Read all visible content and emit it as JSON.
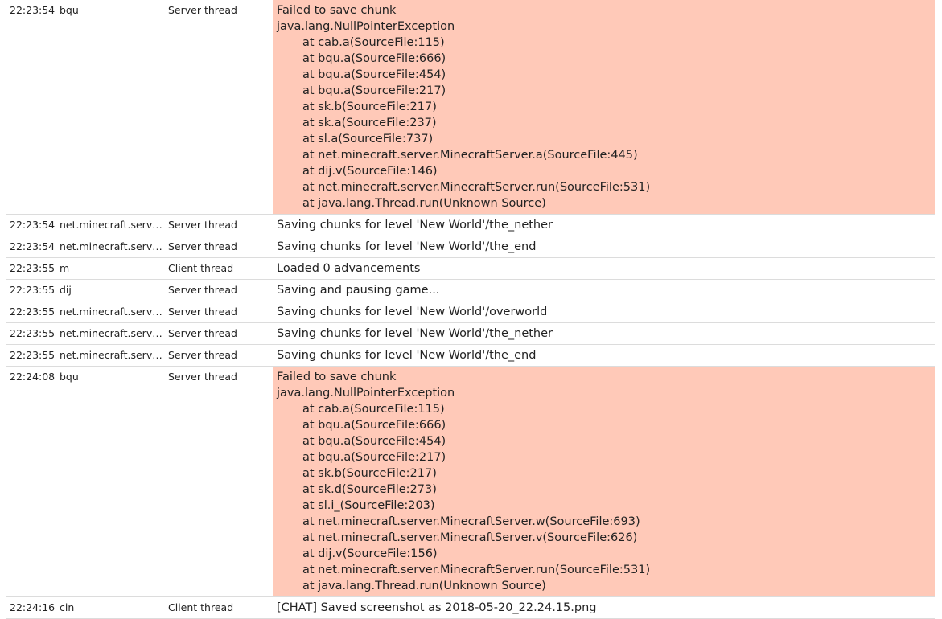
{
  "log": {
    "rows": [
      {
        "time": "22:23:54",
        "logger": "bqu",
        "thread": "Server thread",
        "error": true,
        "lines": [
          "Failed to save chunk",
          "java.lang.NullPointerException",
          "at cab.a(SourceFile:115)",
          "at bqu.a(SourceFile:666)",
          "at bqu.a(SourceFile:454)",
          "at bqu.a(SourceFile:217)",
          "at sk.b(SourceFile:217)",
          "at sk.a(SourceFile:237)",
          "at sl.a(SourceFile:737)",
          "at net.minecraft.server.MinecraftServer.a(SourceFile:445)",
          "at dij.v(SourceFile:146)",
          "at net.minecraft.server.MinecraftServer.run(SourceFile:531)",
          "at java.lang.Thread.run(Unknown Source)"
        ]
      },
      {
        "time": "22:23:54",
        "logger": "net.minecraft.server.MinecraftServer",
        "thread": "Server thread",
        "error": false,
        "lines": [
          "Saving chunks for level 'New World'/the_nether"
        ]
      },
      {
        "time": "22:23:54",
        "logger": "net.minecraft.server.MinecraftServer",
        "thread": "Server thread",
        "error": false,
        "lines": [
          "Saving chunks for level 'New World'/the_end"
        ]
      },
      {
        "time": "22:23:55",
        "logger": "m",
        "thread": "Client thread",
        "error": false,
        "lines": [
          "Loaded 0 advancements"
        ]
      },
      {
        "time": "22:23:55",
        "logger": "dij",
        "thread": "Server thread",
        "error": false,
        "lines": [
          "Saving and pausing game..."
        ]
      },
      {
        "time": "22:23:55",
        "logger": "net.minecraft.server.MinecraftServer",
        "thread": "Server thread",
        "error": false,
        "lines": [
          "Saving chunks for level 'New World'/overworld"
        ]
      },
      {
        "time": "22:23:55",
        "logger": "net.minecraft.server.MinecraftServer",
        "thread": "Server thread",
        "error": false,
        "lines": [
          "Saving chunks for level 'New World'/the_nether"
        ]
      },
      {
        "time": "22:23:55",
        "logger": "net.minecraft.server.MinecraftServer",
        "thread": "Server thread",
        "error": false,
        "lines": [
          "Saving chunks for level 'New World'/the_end"
        ]
      },
      {
        "time": "22:24:08",
        "logger": "bqu",
        "thread": "Server thread",
        "error": true,
        "lines": [
          "Failed to save chunk",
          "java.lang.NullPointerException",
          "at cab.a(SourceFile:115)",
          "at bqu.a(SourceFile:666)",
          "at bqu.a(SourceFile:454)",
          "at bqu.a(SourceFile:217)",
          "at sk.b(SourceFile:217)",
          "at sk.d(SourceFile:273)",
          "at sl.i_(SourceFile:203)",
          "at net.minecraft.server.MinecraftServer.w(SourceFile:693)",
          "at net.minecraft.server.MinecraftServer.v(SourceFile:626)",
          "at dij.v(SourceFile:156)",
          "at net.minecraft.server.MinecraftServer.run(SourceFile:531)",
          "at java.lang.Thread.run(Unknown Source)"
        ]
      },
      {
        "time": "22:24:16",
        "logger": "cin",
        "thread": "Client thread",
        "error": false,
        "lines": [
          "[CHAT] Saved screenshot as 2018-05-20_22.24.15.png"
        ]
      }
    ]
  },
  "colors": {
    "error_background": "#ffc9b8",
    "row_separator": "#dcdcdc"
  }
}
